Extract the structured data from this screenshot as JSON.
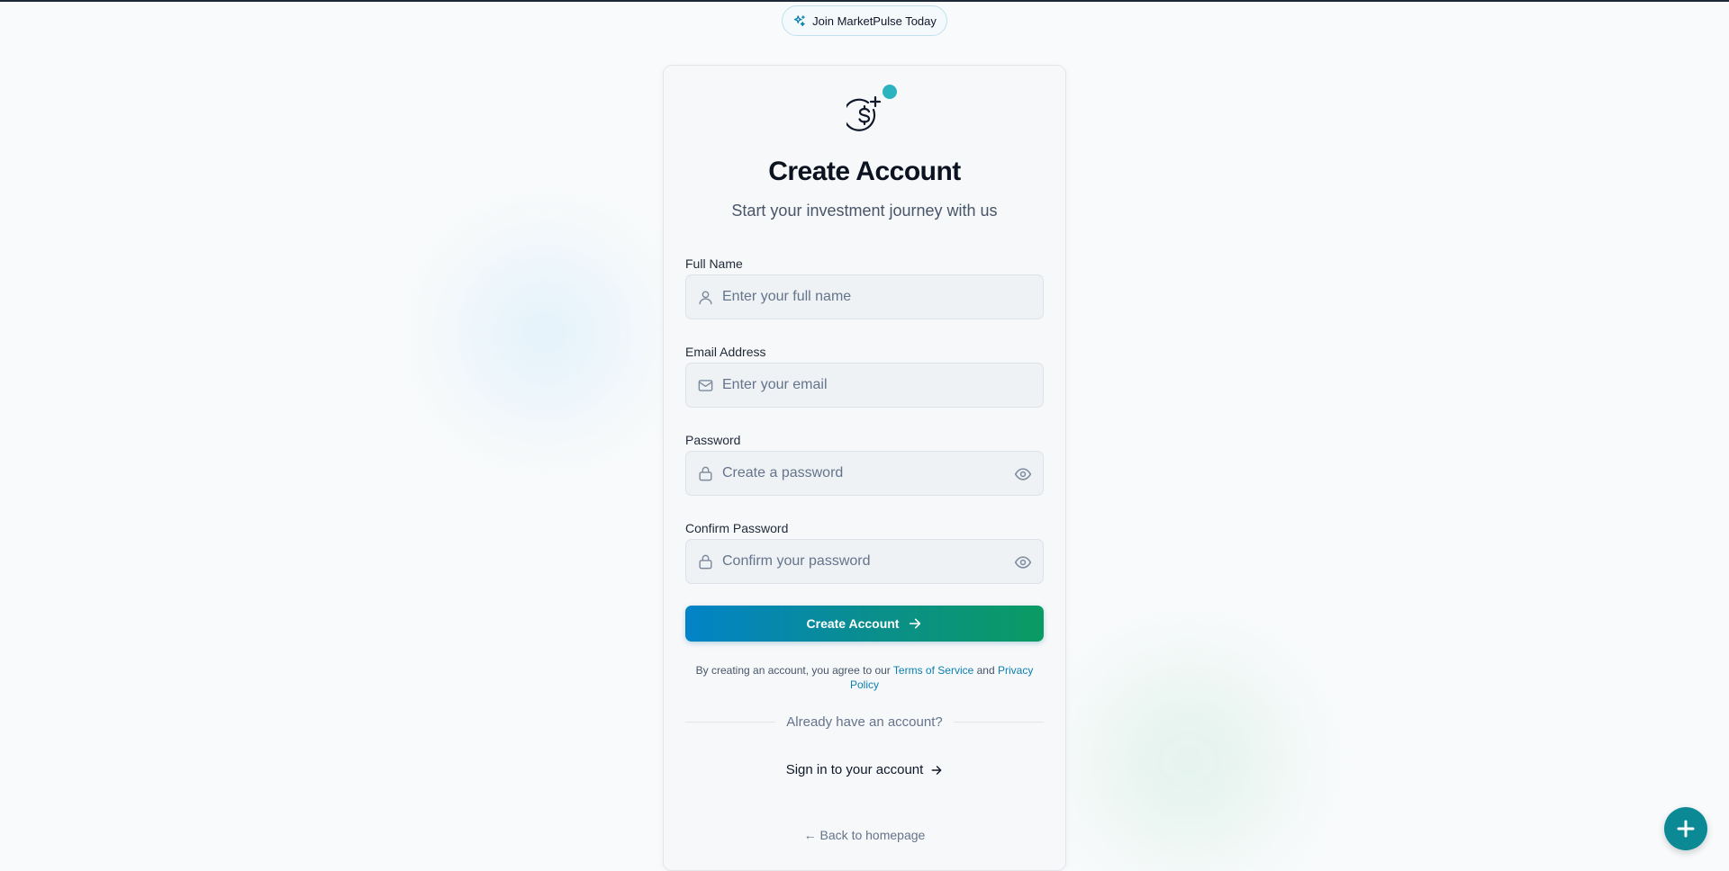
{
  "banner": {
    "label": "Join MarketPulse Today",
    "icon": "sparkles-icon"
  },
  "header": {
    "logo_icon": "dollar-plus-icon",
    "title": "Create Account",
    "subtitle": "Start your investment journey with us"
  },
  "form": {
    "full_name": {
      "label": "Full Name",
      "placeholder": "Enter your full name",
      "value": "",
      "icon": "user-icon"
    },
    "email": {
      "label": "Email Address",
      "placeholder": "Enter your email",
      "value": "",
      "icon": "mail-icon"
    },
    "password": {
      "label": "Password",
      "placeholder": "Create a password",
      "value": "",
      "icon": "lock-icon",
      "toggle_icon": "eye-icon"
    },
    "confirm_password": {
      "label": "Confirm Password",
      "placeholder": "Confirm your password",
      "value": "",
      "icon": "lock-icon",
      "toggle_icon": "eye-icon"
    },
    "submit_label": "Create Account"
  },
  "terms": {
    "prefix": "By creating an account, you agree to our",
    "tos_link": "Terms of Service",
    "conjunction": "and",
    "privacy_link": "Privacy Policy"
  },
  "divider_text": "Already have an account?",
  "signin_label": "Sign in to your account",
  "back_link": "← Back to homepage",
  "fab_icon": "plus-icon",
  "colors": {
    "accent_teal": "#2bb3c0",
    "gradient_start": "#0283c8",
    "gradient_end": "#0a9b63",
    "link": "#0a7fb0",
    "fab": "#0b8a95"
  }
}
